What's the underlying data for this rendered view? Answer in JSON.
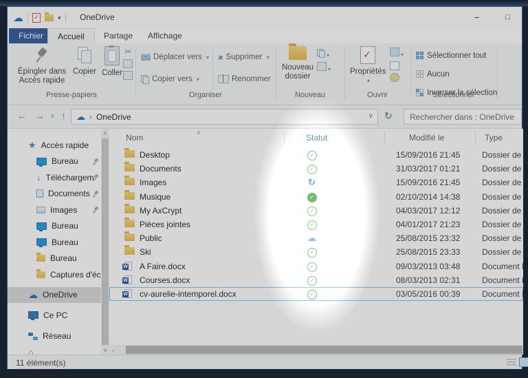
{
  "colors": {
    "accent_blue": "#2b579a",
    "onedrive_blue": "#1173bf",
    "status_green": "#53ae57",
    "status_green_solid": "#2fa436",
    "status_sync_blue": "#1a80d8",
    "status_cloud_blue": "#58a6dd",
    "statut_header_teal": "#3c7f98",
    "selection_border": "#7fc0ea"
  },
  "titlebar": {
    "title": "OneDrive",
    "minimize_glyph": "−",
    "maximize_glyph": "□",
    "qat_dropdown": "▾"
  },
  "tabs": {
    "file": "Fichier",
    "home": "Accueil",
    "share": "Partage",
    "view": "Affichage"
  },
  "ribbon": {
    "pin_to_quick_access": "Épingler dans Accès rapide",
    "copy": "Copier",
    "paste": "Coller",
    "move_to": "Déplacer vers",
    "copy_to": "Copier vers",
    "delete": "Supprimer",
    "rename": "Renommer",
    "new_folder": "Nouveau dossier",
    "properties": "Propriétés",
    "select_all": "Sélectionner tout",
    "select_none": "Aucun",
    "invert_selection": "Inverser la sélection",
    "dropdown_glyph": "▾",
    "delete_glyph": "×",
    "cut_glyph": "✂",
    "groups": {
      "clipboard": "Presse-papiers",
      "organize": "Organiser",
      "new": "Nouveau",
      "open": "Ouvrir",
      "select": "Sélectionner"
    }
  },
  "address_bar": {
    "back_glyph": "←",
    "forward_glyph": "→",
    "recent_glyph": "∨",
    "up_glyph": "↑",
    "crumb_separator": "›",
    "path": "OneDrive",
    "crumb_dropdown": "∨",
    "refresh_glyph": "↻",
    "search_placeholder": "Rechercher dans : OneDrive"
  },
  "sidebar": {
    "items": [
      {
        "label": "Accès rapide",
        "icon": "quick-access-star",
        "level": 0
      },
      {
        "label": "Bureau",
        "icon": "desktop-monitor",
        "level": 1,
        "pinned": true
      },
      {
        "label": "Téléchargem",
        "icon": "downloads-arrow",
        "level": 1,
        "pinned": true
      },
      {
        "label": "Documents",
        "icon": "documents-file",
        "level": 1,
        "pinned": true
      },
      {
        "label": "Images",
        "icon": "pictures-image",
        "level": 1,
        "pinned": true
      },
      {
        "label": "Bureau",
        "icon": "desktop-monitor",
        "level": 1
      },
      {
        "label": "Bureau",
        "icon": "desktop-monitor",
        "level": 1
      },
      {
        "label": "Bureau",
        "icon": "folder",
        "level": 1
      },
      {
        "label": "Captures d'écran",
        "icon": "folder",
        "level": 1
      },
      {
        "label": "OneDrive",
        "icon": "onedrive-cloud",
        "level": 0,
        "selected": true,
        "gap": 6
      },
      {
        "label": "Ce PC",
        "icon": "this-pc",
        "level": 0,
        "gap": 6
      },
      {
        "label": "Réseau",
        "icon": "network",
        "level": 0,
        "gap": 7
      },
      {
        "label": "",
        "icon": "homegroup",
        "level": 0
      }
    ]
  },
  "list": {
    "columns": [
      "Nom",
      "Statut",
      "Modifié le",
      "Type"
    ],
    "sort_glyph": "∧",
    "rows": [
      {
        "name": "Desktop",
        "icon": "folder",
        "status": "synced",
        "modified": "15/09/2016 21:45",
        "type": "Dossier de fic"
      },
      {
        "name": "Documents",
        "icon": "folder",
        "status": "synced",
        "modified": "31/03/2017 01:21",
        "type": "Dossier de fic"
      },
      {
        "name": "Images",
        "icon": "folder",
        "status": "syncing",
        "modified": "15/09/2016 21:45",
        "type": "Dossier de fic"
      },
      {
        "name": "Musique",
        "icon": "folder",
        "status": "synced-solid",
        "modified": "02/10/2014 14:38",
        "type": "Dossier de fic"
      },
      {
        "name": "My AxCrypt",
        "icon": "folder",
        "status": "synced",
        "modified": "04/03/2017 12:12",
        "type": "Dossier de fic"
      },
      {
        "name": "Pièces jointes",
        "icon": "folder",
        "status": "synced",
        "modified": "04/01/2017 21:23",
        "type": "Dossier de fic"
      },
      {
        "name": "Public",
        "icon": "folder",
        "status": "cloud-only",
        "modified": "25/08/2015 23:32",
        "type": "Dossier de fic"
      },
      {
        "name": "Ski",
        "icon": "folder",
        "status": "synced",
        "modified": "25/08/2015 23:33",
        "type": "Dossier de fic"
      },
      {
        "name": "A Faire.docx",
        "icon": "word",
        "status": "synced",
        "modified": "09/03/2013 03:48",
        "type": "Document M"
      },
      {
        "name": "Courses.docx",
        "icon": "word",
        "status": "synced",
        "modified": "08/03/2013 02:31",
        "type": "Document M"
      },
      {
        "name": "cv-aurelie-intemporel.docx",
        "icon": "word",
        "status": "synced",
        "modified": "03/05/2016 00:39",
        "type": "Document M",
        "selected": true
      }
    ],
    "status_glyphs": {
      "synced": "✓",
      "synced-solid": "✓",
      "syncing": "↻",
      "cloud-only": "☁"
    }
  },
  "scrollbars": {
    "up_glyph": "∧",
    "down_glyph": "∨",
    "left_glyph": "‹"
  },
  "status_bar": {
    "count": "11 élément(s)"
  }
}
